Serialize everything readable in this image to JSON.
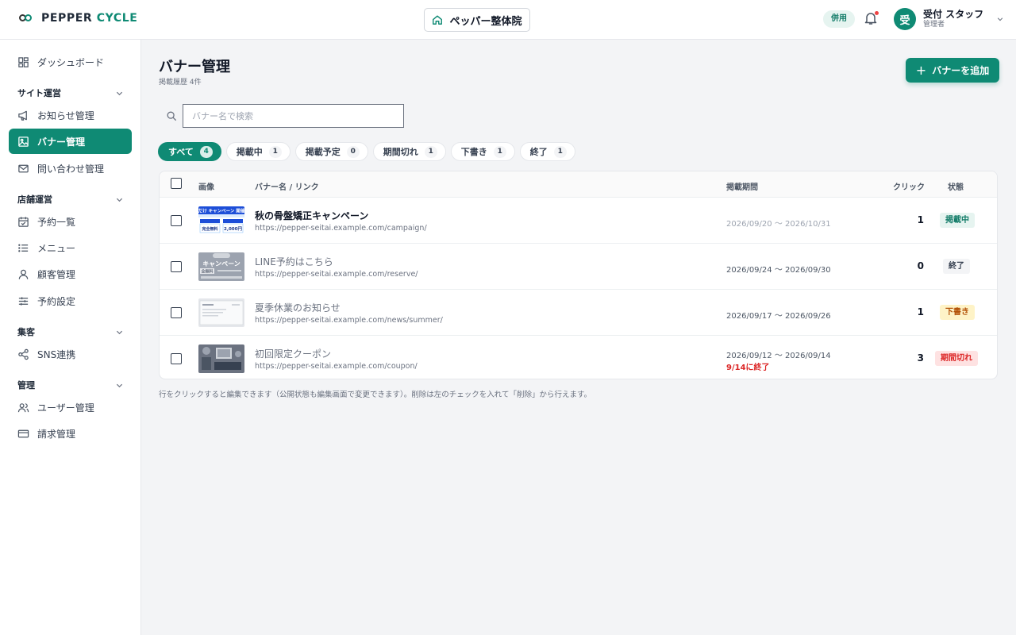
{
  "brand": {
    "name_main": "PEPPER",
    "name_accent": "CYCLE"
  },
  "header": {
    "store_name": "ペッパー整体院",
    "mode_badge": "併用",
    "user_avatar": "受",
    "user_name": "受付 スタッフ",
    "user_role": "管理者"
  },
  "sidebar": {
    "dashboard": "ダッシュボード",
    "sections": {
      "site": "サイト運営",
      "store": "店舗運営",
      "marketing": "集客",
      "admin": "管理"
    },
    "items": {
      "news": "お知らせ管理",
      "banners": "バナー管理",
      "inquiries": "問い合わせ管理",
      "reservations": "予約一覧",
      "menu": "メニュー",
      "customers": "顧客管理",
      "reservation_settings": "予約設定",
      "sns": "SNS連携",
      "users": "ユーザー管理",
      "billing": "請求管理"
    }
  },
  "page": {
    "title": "バナー管理",
    "subtitle": "掲載履歴 4件",
    "add_button": "バナーを追加",
    "search_placeholder": "バナー名で検索",
    "footnote": "行をクリックすると編集できます（公開状態も編集画面で変更できます）。削除は左のチェックを入れて「削除」から行えます。"
  },
  "filters": [
    {
      "label": "すべて",
      "count": "4",
      "active": true
    },
    {
      "label": "掲載中",
      "count": "1"
    },
    {
      "label": "掲載予定",
      "count": "0"
    },
    {
      "label": "期間切れ",
      "count": "1"
    },
    {
      "label": "下書き",
      "count": "1"
    },
    {
      "label": "終了",
      "count": "1"
    }
  ],
  "table": {
    "headers": {
      "image": "画像",
      "name": "バナー名 / リンク",
      "period": "掲載期間",
      "clicks": "クリック",
      "status": "状態"
    },
    "rows": [
      {
        "name": "秋の骨盤矯正キャンペーン",
        "url": "https://pepper-seitai.example.com/campaign/",
        "period": "2026/09/20 〜 2026/10/31",
        "clicks": "1",
        "status": "掲載中",
        "thumb": {
          "top": "秋だけ キャンペーン 開催中",
          "left": "完全無料",
          "right": "2,000円"
        }
      },
      {
        "name": "LINE予約はこちら",
        "url": "https://pepper-seitai.example.com/reserve/",
        "period": "2026/09/24 〜 2026/09/30",
        "clicks": "0",
        "status": "終了",
        "thumb": {
          "top": "キャンペーン",
          "left": "全無料"
        }
      },
      {
        "name": "夏季休業のお知らせ",
        "url": "https://pepper-seitai.example.com/news/summer/",
        "period": "2026/09/17 〜 2026/09/26",
        "clicks": "1",
        "status": "下書き"
      },
      {
        "name": "初回限定クーポン",
        "url": "https://pepper-seitai.example.com/coupon/",
        "period": "2026/09/12 〜 2026/09/14",
        "period_note": "9/14に終了",
        "clicks": "3",
        "status": "期間切れ"
      }
    ]
  },
  "colors": {
    "accent": "#0f8a74",
    "status_live": "#0f7a66",
    "status_draft": "#b45309",
    "status_expired": "#dc2626"
  }
}
